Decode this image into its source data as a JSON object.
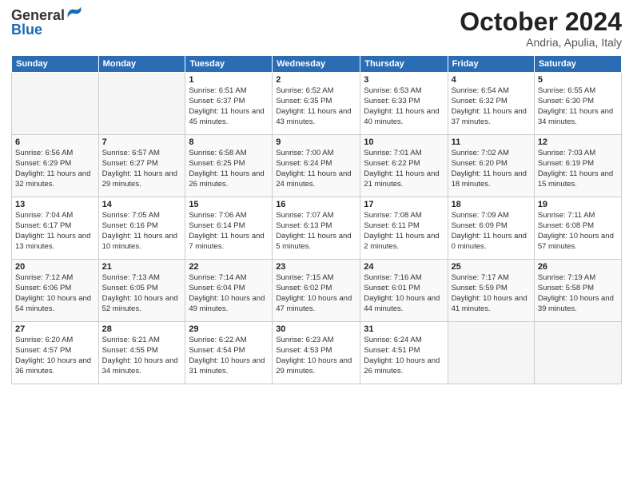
{
  "header": {
    "logo_general": "General",
    "logo_blue": "Blue",
    "month_title": "October 2024",
    "subtitle": "Andria, Apulia, Italy"
  },
  "weekdays": [
    "Sunday",
    "Monday",
    "Tuesday",
    "Wednesday",
    "Thursday",
    "Friday",
    "Saturday"
  ],
  "weeks": [
    [
      {
        "day": "",
        "empty": true
      },
      {
        "day": "",
        "empty": true
      },
      {
        "day": "1",
        "sunrise": "6:51 AM",
        "sunset": "6:37 PM",
        "daylight": "11 hours and 45 minutes."
      },
      {
        "day": "2",
        "sunrise": "6:52 AM",
        "sunset": "6:35 PM",
        "daylight": "11 hours and 43 minutes."
      },
      {
        "day": "3",
        "sunrise": "6:53 AM",
        "sunset": "6:33 PM",
        "daylight": "11 hours and 40 minutes."
      },
      {
        "day": "4",
        "sunrise": "6:54 AM",
        "sunset": "6:32 PM",
        "daylight": "11 hours and 37 minutes."
      },
      {
        "day": "5",
        "sunrise": "6:55 AM",
        "sunset": "6:30 PM",
        "daylight": "11 hours and 34 minutes."
      }
    ],
    [
      {
        "day": "6",
        "sunrise": "6:56 AM",
        "sunset": "6:29 PM",
        "daylight": "11 hours and 32 minutes."
      },
      {
        "day": "7",
        "sunrise": "6:57 AM",
        "sunset": "6:27 PM",
        "daylight": "11 hours and 29 minutes."
      },
      {
        "day": "8",
        "sunrise": "6:58 AM",
        "sunset": "6:25 PM",
        "daylight": "11 hours and 26 minutes."
      },
      {
        "day": "9",
        "sunrise": "7:00 AM",
        "sunset": "6:24 PM",
        "daylight": "11 hours and 24 minutes."
      },
      {
        "day": "10",
        "sunrise": "7:01 AM",
        "sunset": "6:22 PM",
        "daylight": "11 hours and 21 minutes."
      },
      {
        "day": "11",
        "sunrise": "7:02 AM",
        "sunset": "6:20 PM",
        "daylight": "11 hours and 18 minutes."
      },
      {
        "day": "12",
        "sunrise": "7:03 AM",
        "sunset": "6:19 PM",
        "daylight": "11 hours and 15 minutes."
      }
    ],
    [
      {
        "day": "13",
        "sunrise": "7:04 AM",
        "sunset": "6:17 PM",
        "daylight": "11 hours and 13 minutes."
      },
      {
        "day": "14",
        "sunrise": "7:05 AM",
        "sunset": "6:16 PM",
        "daylight": "11 hours and 10 minutes."
      },
      {
        "day": "15",
        "sunrise": "7:06 AM",
        "sunset": "6:14 PM",
        "daylight": "11 hours and 7 minutes."
      },
      {
        "day": "16",
        "sunrise": "7:07 AM",
        "sunset": "6:13 PM",
        "daylight": "11 hours and 5 minutes."
      },
      {
        "day": "17",
        "sunrise": "7:08 AM",
        "sunset": "6:11 PM",
        "daylight": "11 hours and 2 minutes."
      },
      {
        "day": "18",
        "sunrise": "7:09 AM",
        "sunset": "6:09 PM",
        "daylight": "11 hours and 0 minutes."
      },
      {
        "day": "19",
        "sunrise": "7:11 AM",
        "sunset": "6:08 PM",
        "daylight": "10 hours and 57 minutes."
      }
    ],
    [
      {
        "day": "20",
        "sunrise": "7:12 AM",
        "sunset": "6:06 PM",
        "daylight": "10 hours and 54 minutes."
      },
      {
        "day": "21",
        "sunrise": "7:13 AM",
        "sunset": "6:05 PM",
        "daylight": "10 hours and 52 minutes."
      },
      {
        "day": "22",
        "sunrise": "7:14 AM",
        "sunset": "6:04 PM",
        "daylight": "10 hours and 49 minutes."
      },
      {
        "day": "23",
        "sunrise": "7:15 AM",
        "sunset": "6:02 PM",
        "daylight": "10 hours and 47 minutes."
      },
      {
        "day": "24",
        "sunrise": "7:16 AM",
        "sunset": "6:01 PM",
        "daylight": "10 hours and 44 minutes."
      },
      {
        "day": "25",
        "sunrise": "7:17 AM",
        "sunset": "5:59 PM",
        "daylight": "10 hours and 41 minutes."
      },
      {
        "day": "26",
        "sunrise": "7:19 AM",
        "sunset": "5:58 PM",
        "daylight": "10 hours and 39 minutes."
      }
    ],
    [
      {
        "day": "27",
        "sunrise": "6:20 AM",
        "sunset": "4:57 PM",
        "daylight": "10 hours and 36 minutes."
      },
      {
        "day": "28",
        "sunrise": "6:21 AM",
        "sunset": "4:55 PM",
        "daylight": "10 hours and 34 minutes."
      },
      {
        "day": "29",
        "sunrise": "6:22 AM",
        "sunset": "4:54 PM",
        "daylight": "10 hours and 31 minutes."
      },
      {
        "day": "30",
        "sunrise": "6:23 AM",
        "sunset": "4:53 PM",
        "daylight": "10 hours and 29 minutes."
      },
      {
        "day": "31",
        "sunrise": "6:24 AM",
        "sunset": "4:51 PM",
        "daylight": "10 hours and 26 minutes."
      },
      {
        "day": "",
        "empty": true
      },
      {
        "day": "",
        "empty": true
      }
    ]
  ]
}
